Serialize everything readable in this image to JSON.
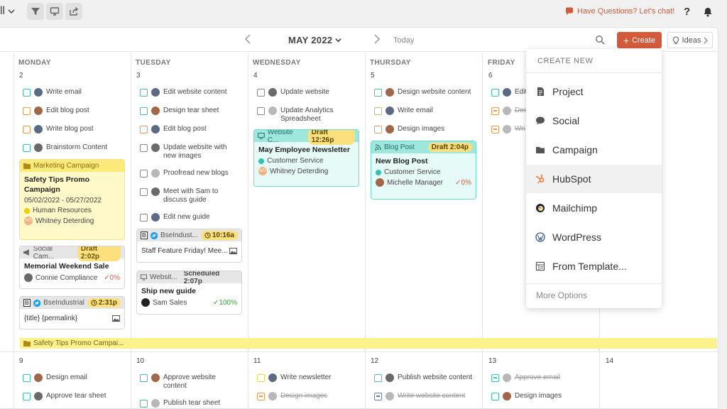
{
  "toolbar": {
    "view_label": "ll",
    "chat_label": "Have Questions? Let's chat!",
    "help_label": "?"
  },
  "header": {
    "month_label": "MAY 2022",
    "today_label": "Today",
    "create_label": "Create",
    "ideas_label": "Ideas"
  },
  "days": {
    "mon": "MONDAY",
    "tue": "TUESDAY",
    "wed": "WEDNESDAY",
    "thu": "THURSDAY",
    "fri": "FRIDAY",
    "n2": "2",
    "n3": "3",
    "n4": "4",
    "n5": "5",
    "n6": "6",
    "n9": "9",
    "n10": "10",
    "n11": "11",
    "n12": "12",
    "n13": "13",
    "n14": "14"
  },
  "tasks": {
    "mon1": "Write email",
    "mon2": "Edit blog post",
    "mon3": "Write blog post",
    "mon4": "Brainstorm Content",
    "tue1": "Edit website content",
    "tue2": "Design tear sheet",
    "tue3": "Edit blog post",
    "tue4": "Update website with new images",
    "tue5": "Proofread new blogs",
    "tue6": "Meet with Sam to discuss guide",
    "tue7": "Edit new guide",
    "wed1": "Update website",
    "wed2": "Update Analytics Spreadsheet",
    "thu1": "Design website content",
    "thu2": "Write email",
    "thu3": "Design images",
    "fri1": "Edit",
    "fri2": "Des",
    "fri3": "Wri",
    "w2mon1": "Design email",
    "w2mon2": "Approve tear sheet",
    "w2tue1": "Approve website content",
    "w2tue2": "Publish tear sheet",
    "w2wed1": "Write newsletter",
    "w2wed2": "Design images",
    "w2thu1": "Publish website content",
    "w2thu2": "Write website content",
    "w2fri1": "Approve email",
    "w2fri2": "Design images"
  },
  "cards": {
    "campaign": {
      "tag": "Marketing Campaign",
      "title": "Safety Tips Promo Campaign",
      "dates": "05/02/2022 - 05/27/2022",
      "team": "Human Resources",
      "owner": "Whitney Deterding",
      "initials": "WD"
    },
    "social_mon": {
      "tag": "Social Cam...",
      "status": "Draft 2:02p",
      "title": "Memorial Weekend Sale",
      "owner": "Connie Compliance",
      "pct": "0%"
    },
    "bse_mon": {
      "tag": "BseIndustrial",
      "time": "2:31p",
      "body": "{title} {permalink}"
    },
    "bse_tue": {
      "tag": "BseIndust...",
      "time": "10:16a",
      "body": "Staff Feature Friday! Mee..."
    },
    "web_tue": {
      "tag": "Websit...",
      "status": "Scheduled 2:07p",
      "title": "Ship new guide",
      "owner": "Sam Sales",
      "pct": "100%"
    },
    "web_wed": {
      "tag": "Website C...",
      "status": "Draft 12:26p",
      "title": "May Employee Newsletter",
      "team": "Customer Service",
      "owner": "Whitney Deterding",
      "initials": "WD"
    },
    "blog_thu": {
      "tag": "Blog Post",
      "status": "Draft 2:04p",
      "title": "New Blog Post",
      "team": "Customer Service",
      "owner": "Michelle Manager",
      "pct": "0%"
    }
  },
  "campaign_bar": "Safety Tips Promo Campai...",
  "dropdown": {
    "heading": "CREATE NEW",
    "items": [
      "Project",
      "Social",
      "Campaign",
      "HubSpot",
      "Mailchimp",
      "WordPress",
      "From Template..."
    ],
    "more": "More Options"
  },
  "colors": {
    "accent": "#d35b3c",
    "teal": "#3cc2b5",
    "campaign_yellow": "#fbf28e"
  }
}
